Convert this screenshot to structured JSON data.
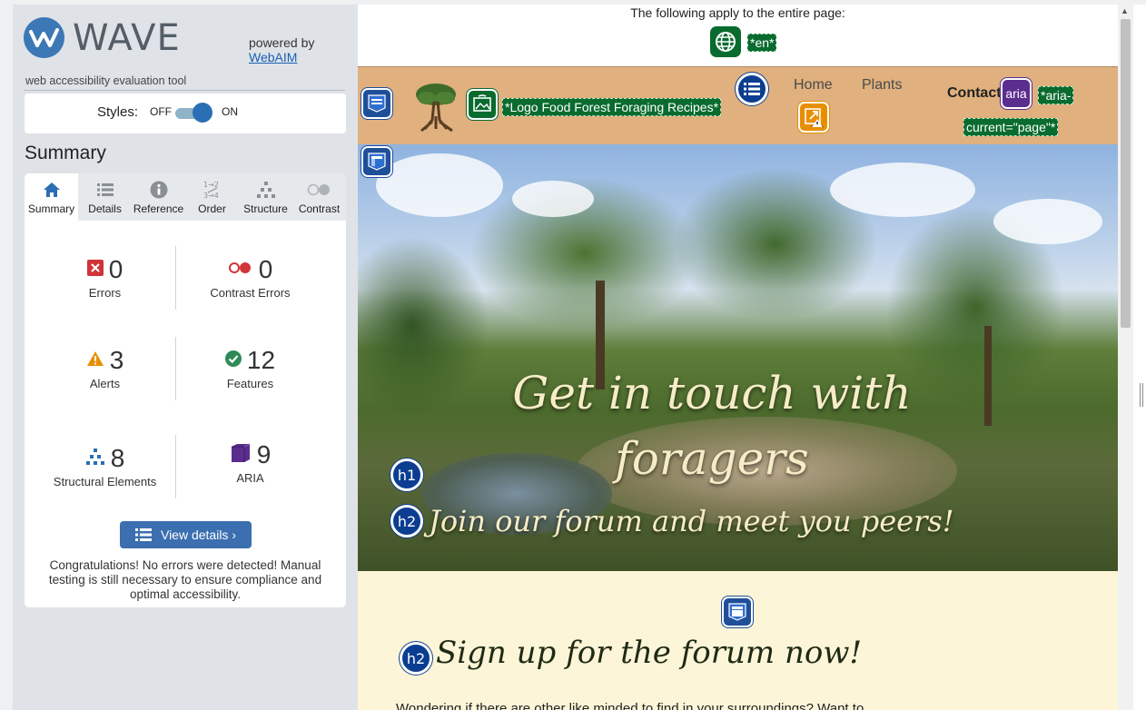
{
  "wave": {
    "logo_text": "WAVE",
    "logo_sub": "web accessibility evaluation tool",
    "powered_by": "powered by",
    "webaim": "WebAIM",
    "styles_label": "Styles:",
    "styles_off": "OFF",
    "styles_on": "ON",
    "summary_title": "Summary",
    "tabs": [
      {
        "label": "Summary",
        "icon": "home-icon"
      },
      {
        "label": "Details",
        "icon": "list-icon"
      },
      {
        "label": "Reference",
        "icon": "info-icon"
      },
      {
        "label": "Order",
        "icon": "order-icon"
      },
      {
        "label": "Structure",
        "icon": "structure-icon"
      },
      {
        "label": "Contrast",
        "icon": "contrast-icon"
      }
    ],
    "stats": {
      "errors": {
        "value": "0",
        "label": "Errors"
      },
      "contrast": {
        "value": "0",
        "label": "Contrast Errors"
      },
      "alerts": {
        "value": "3",
        "label": "Alerts"
      },
      "features": {
        "value": "12",
        "label": "Features"
      },
      "structural": {
        "value": "8",
        "label": "Structural Elements"
      },
      "aria": {
        "value": "9",
        "label": "ARIA"
      }
    },
    "view_details": "View details ›",
    "congrats": "Congratulations! No errors were detected! Manual testing is still necessary to ensure compliance and optimal accessibility."
  },
  "page": {
    "applies_text": "The following apply to the entire page:",
    "lang_tag": "*en*",
    "logo_tag": "*Logo Food Forest Foraging Recipes*",
    "nav": {
      "home": "Home",
      "plants": "Plants",
      "contact": "Contact"
    },
    "aria_tag_line1": "*aria-",
    "aria_tag_line2": "current=\"page\"*",
    "aria_badge": "aria",
    "h1_badge": "h1",
    "h2_badge": "h2",
    "hero_title": "Get in touch with foragers",
    "hero_sub": "Join our forum and meet you peers!",
    "signup_title": "Sign up for the forum now!",
    "signup_text": "Wondering if there are other like minded to find in your surroundings? Want to"
  },
  "colors": {
    "wave_blue": "#3b78b5",
    "error_red": "#d13438",
    "alert_orange": "#e88f00",
    "feature_green": "#2e8b57",
    "aria_purple": "#5b2d8e",
    "nav_bg": "#e0b07e",
    "signup_bg": "#fcf5d8"
  }
}
